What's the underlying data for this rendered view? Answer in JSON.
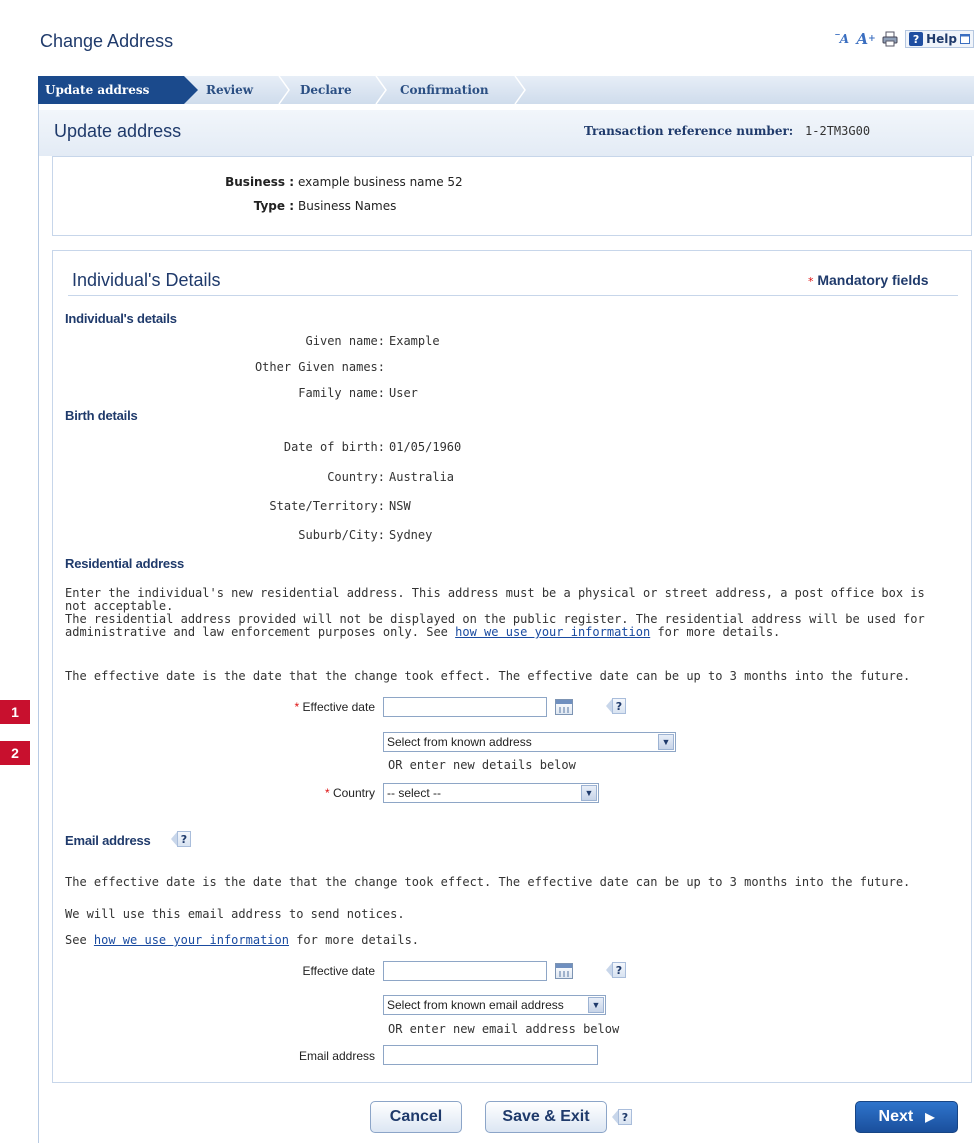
{
  "header": {
    "title": "Change Address"
  },
  "tools": {
    "decrease_font": "A",
    "increase_font": "A",
    "help_label": "Help"
  },
  "wizard": {
    "steps": [
      "Update address",
      "Review",
      "Declare",
      "Confirmation"
    ],
    "active": 0
  },
  "subheader": {
    "title": "Update address",
    "txn_label": "Transaction reference number:",
    "txn_value": "1-2TM3G00"
  },
  "business": {
    "business_label": "Business :",
    "business_value": "example business name 52",
    "type_label": "Type :",
    "type_value": "Business Names"
  },
  "details": {
    "title": "Individual's Details",
    "mandatory_star": "*",
    "mandatory_text": "Mandatory fields",
    "individual": {
      "heading": "Individual's details",
      "given_label": "Given name:",
      "given_value": "Example",
      "other_label": "Other Given names:",
      "other_value": "",
      "family_label": "Family name:",
      "family_value": "User"
    },
    "birth": {
      "heading": "Birth details",
      "dob_label": "Date of birth:",
      "dob_value": "01/05/1960",
      "country_label": "Country:",
      "country_value": "Australia",
      "state_label": "State/Territory:",
      "state_value": "NSW",
      "suburb_label": "Suburb/City:",
      "suburb_value": "Sydney"
    },
    "residential": {
      "heading": "Residential address",
      "para1": "Enter the individual's new residential address. This address must be a physical or street address, a post office box is not acceptable.",
      "para2_pre": "The residential address provided will not be displayed on the public register. The residential address will be used for administrative and law enforcement purposes only. See ",
      "para2_link": "how we use your information",
      "para2_post": " for more details.",
      "effective_note": "The effective date is the date that the change took effect. The effective date can be up to 3 months into the future.",
      "effective_label": "Effective date",
      "effective_value": "",
      "known_select": "Select from known address",
      "or_text": "OR enter new details below",
      "country_label": "Country",
      "country_select": "-- select --"
    },
    "email": {
      "heading": "Email address",
      "effective_note": "The effective date is the date that the change took effect. The effective date can be up to 3 months into the future.",
      "notice_text": "We will use this email address to send notices.",
      "see_pre": "See ",
      "see_link": "how we use your information",
      "see_post": " for more details.",
      "effective_label": "Effective date",
      "effective_value": "",
      "known_select": "Select from known email address",
      "or_text": "OR enter new email address below",
      "email_label": "Email address",
      "email_value": ""
    }
  },
  "footer": {
    "cancel": "Cancel",
    "save_exit": "Save & Exit",
    "next": "Next"
  },
  "badges": [
    "1",
    "2"
  ]
}
